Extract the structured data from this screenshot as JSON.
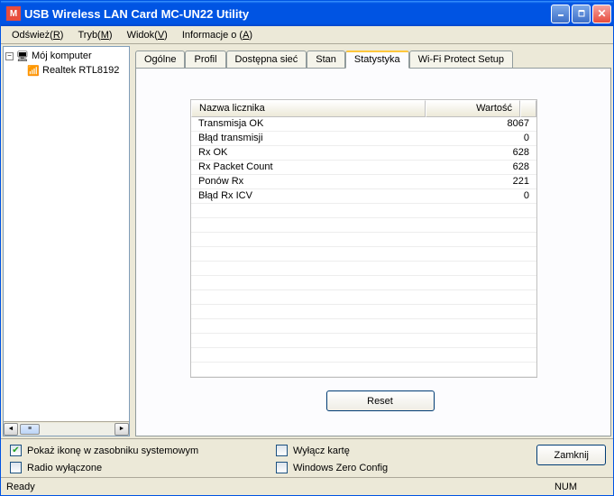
{
  "window": {
    "title": "USB Wireless LAN Card MC-UN22 Utility"
  },
  "menu": [
    {
      "pre": "Odśwież(",
      "key": "R",
      "post": ")"
    },
    {
      "pre": "Tryb(",
      "key": "M",
      "post": ")"
    },
    {
      "pre": "Widok(",
      "key": "V",
      "post": ")"
    },
    {
      "pre": "Informacje o (",
      "key": "A",
      "post": ")"
    }
  ],
  "tree": {
    "root": "Mój komputer",
    "adapter": "Realtek RTL8192"
  },
  "tabs": [
    "Ogólne",
    "Profil",
    "Dostępna sieć",
    "Stan",
    "Statystyka",
    "Wi-Fi Protect Setup"
  ],
  "active_tab": 4,
  "table": {
    "headers": [
      "Nazwa licznika",
      "Wartość"
    ],
    "rows": [
      {
        "name": "Transmisja OK",
        "value": "8067"
      },
      {
        "name": "Błąd transmisji",
        "value": "0"
      },
      {
        "name": "Rx OK",
        "value": "628"
      },
      {
        "name": "Rx Packet Count",
        "value": "628"
      },
      {
        "name": "Ponów Rx",
        "value": "221"
      },
      {
        "name": "Błąd Rx ICV",
        "value": "0"
      }
    ],
    "empty_rows": 12
  },
  "buttons": {
    "reset": "Reset",
    "close": "Zamknij"
  },
  "options": [
    {
      "label": "Pokaż ikonę w zasobniku systemowym",
      "checked": true
    },
    {
      "label": "Radio wyłączone",
      "checked": false
    },
    {
      "label": "Wyłącz kartę",
      "checked": false
    },
    {
      "label": "Windows Zero Config",
      "checked": false
    }
  ],
  "status": {
    "text": "Ready",
    "num": "NUM"
  }
}
